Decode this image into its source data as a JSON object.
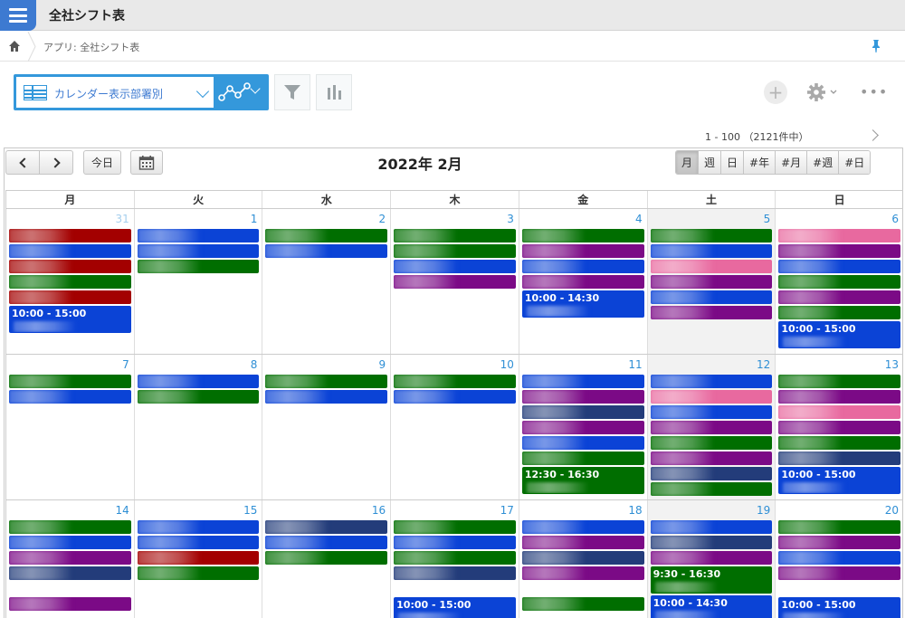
{
  "app": {
    "title": "全社シフト表",
    "icon": "app-list-icon"
  },
  "breadcrumb": {
    "home_icon": "home-icon",
    "text": "アプリ: 全社シフト表",
    "pin_icon": "pin-icon"
  },
  "toolbar": {
    "view_name": "カレンダー表示部署別",
    "graph_icon": "graph-icon",
    "filter_icon": "filter-icon",
    "chart_icon": "bar-chart-icon",
    "plus": "+",
    "more": "•••"
  },
  "pager": {
    "text": "1 - 100 （2121件中）"
  },
  "calendar": {
    "title": "2022年 2月",
    "today_label": "今日",
    "view_tabs": [
      "月",
      "週",
      "日",
      "#年",
      "#月",
      "#週",
      "#日"
    ],
    "active_tab": "月",
    "weekdays": [
      "月",
      "火",
      "水",
      "木",
      "金",
      "土",
      "日"
    ],
    "colors": {
      "red": "#a30000",
      "blue": "#0b43d6",
      "green": "#006e00",
      "purple": "#7b0a86",
      "pink": "#e8699f",
      "navy": "#233c7a"
    },
    "weeks": [
      [
        {
          "num": "31",
          "other": true,
          "events": [
            {
              "c": "red"
            },
            {
              "c": "blue"
            },
            {
              "c": "red"
            },
            {
              "c": "green"
            },
            {
              "c": "red"
            },
            {
              "c": "blue",
              "time": "10:00 - 15:00"
            }
          ]
        },
        {
          "num": "1",
          "events": [
            {
              "c": "blue"
            },
            {
              "c": "blue"
            },
            {
              "c": "green"
            }
          ]
        },
        {
          "num": "2",
          "events": [
            {
              "c": "green"
            },
            {
              "c": "blue"
            }
          ]
        },
        {
          "num": "3",
          "events": [
            {
              "c": "green"
            },
            {
              "c": "green"
            },
            {
              "c": "blue"
            },
            {
              "c": "purple"
            }
          ]
        },
        {
          "num": "4",
          "events": [
            {
              "c": "green"
            },
            {
              "c": "purple"
            },
            {
              "c": "blue"
            },
            {
              "c": "purple"
            },
            {
              "c": "blue",
              "time": "10:00 - 14:30"
            }
          ]
        },
        {
          "num": "5",
          "sat": true,
          "events": [
            {
              "c": "green"
            },
            {
              "c": "blue"
            },
            {
              "c": "pink"
            },
            {
              "c": "purple"
            },
            {
              "c": "blue"
            },
            {
              "c": "purple"
            }
          ]
        },
        {
          "num": "6",
          "events": [
            {
              "c": "pink"
            },
            {
              "c": "purple"
            },
            {
              "c": "blue"
            },
            {
              "c": "green"
            },
            {
              "c": "purple"
            },
            {
              "c": "green"
            },
            {
              "c": "blue",
              "time": "10:00 - 15:00"
            }
          ]
        }
      ],
      [
        {
          "num": "7",
          "events": [
            {
              "c": "green"
            },
            {
              "c": "blue"
            }
          ]
        },
        {
          "num": "8",
          "events": [
            {
              "c": "blue"
            },
            {
              "c": "green"
            }
          ]
        },
        {
          "num": "9",
          "events": [
            {
              "c": "green"
            },
            {
              "c": "blue"
            }
          ]
        },
        {
          "num": "10",
          "events": [
            {
              "c": "green"
            },
            {
              "c": "blue"
            }
          ]
        },
        {
          "num": "11",
          "events": [
            {
              "c": "blue"
            },
            {
              "c": "purple"
            },
            {
              "c": "navy"
            },
            {
              "c": "purple"
            },
            {
              "c": "blue"
            },
            {
              "c": "green"
            },
            {
              "c": "green",
              "time": "12:30 - 16:30"
            }
          ]
        },
        {
          "num": "12",
          "sat": true,
          "events": [
            {
              "c": "blue"
            },
            {
              "c": "pink"
            },
            {
              "c": "blue"
            },
            {
              "c": "purple"
            },
            {
              "c": "green"
            },
            {
              "c": "purple"
            },
            {
              "c": "navy"
            },
            {
              "c": "green"
            }
          ]
        },
        {
          "num": "13",
          "events": [
            {
              "c": "green"
            },
            {
              "c": "purple"
            },
            {
              "c": "pink"
            },
            {
              "c": "purple"
            },
            {
              "c": "green"
            },
            {
              "c": "navy"
            },
            {
              "c": "blue",
              "time": "10:00 - 15:00"
            }
          ]
        }
      ],
      [
        {
          "num": "14",
          "events": [
            {
              "c": "green"
            },
            {
              "c": "blue"
            },
            {
              "c": "purple"
            },
            {
              "c": "navy"
            },
            {
              "c": "none"
            },
            {
              "c": "purple"
            }
          ]
        },
        {
          "num": "15",
          "events": [
            {
              "c": "blue"
            },
            {
              "c": "blue"
            },
            {
              "c": "red"
            },
            {
              "c": "green"
            }
          ]
        },
        {
          "num": "16",
          "events": [
            {
              "c": "navy"
            },
            {
              "c": "blue"
            },
            {
              "c": "green"
            }
          ]
        },
        {
          "num": "17",
          "events": [
            {
              "c": "green"
            },
            {
              "c": "blue"
            },
            {
              "c": "green"
            },
            {
              "c": "navy"
            },
            {
              "c": "none"
            },
            {
              "c": "blue",
              "time": "10:00 - 15:00"
            }
          ]
        },
        {
          "num": "18",
          "events": [
            {
              "c": "blue"
            },
            {
              "c": "purple"
            },
            {
              "c": "navy"
            },
            {
              "c": "purple"
            },
            {
              "c": "none"
            },
            {
              "c": "green"
            }
          ]
        },
        {
          "num": "19",
          "sat": true,
          "events": [
            {
              "c": "blue"
            },
            {
              "c": "navy"
            },
            {
              "c": "purple"
            },
            {
              "c": "green",
              "time": "9:30 - 16:30"
            },
            {
              "c": "blue",
              "time": "10:00 - 14:30"
            }
          ]
        },
        {
          "num": "20",
          "events": [
            {
              "c": "green"
            },
            {
              "c": "purple"
            },
            {
              "c": "blue"
            },
            {
              "c": "purple"
            },
            {
              "c": "none"
            },
            {
              "c": "blue",
              "time": "10:00 - 15:00"
            }
          ]
        }
      ]
    ]
  }
}
